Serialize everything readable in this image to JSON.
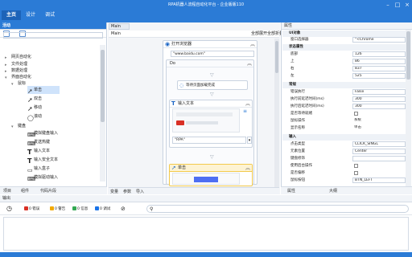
{
  "titlebar": {
    "title": "RPA机器人流程自动化平台 - 企业版版110"
  },
  "menu": {
    "tabs": [
      "主页",
      "设计",
      "调试"
    ]
  },
  "left": {
    "header": "活动",
    "tree": [
      {
        "label": "网页自动化"
      },
      {
        "label": "文件处理"
      },
      {
        "label": "数据处理"
      },
      {
        "label": "界面自动化"
      },
      {
        "label": "鼠标"
      },
      {
        "label": "单击"
      },
      {
        "label": "双击"
      },
      {
        "label": "移动"
      },
      {
        "label": "滚动"
      },
      {
        "label": "键盘"
      },
      {
        "label": "模拟键盘输入"
      },
      {
        "label": "发送热键"
      },
      {
        "label": "输入文本"
      },
      {
        "label": "输入安全文本"
      },
      {
        "label": "输入盒子"
      },
      {
        "label": "模拟驱动输入"
      }
    ],
    "footer_tabs": [
      "项目",
      "组件",
      "代码片段"
    ]
  },
  "center": {
    "tab": "Main",
    "breadcrumb": "Main",
    "expand_all": "全部展开",
    "collapse_all": "全部折叠",
    "blocks": {
      "open_browser": {
        "title": "打开浏览器",
        "url": "\"www.baidu.com\""
      },
      "do": {
        "title": "Do"
      },
      "wait": {
        "label": "等待页面加载完成"
      },
      "type_text": {
        "title": "输入文本",
        "text": "\"RPA\""
      },
      "click": {
        "title": "单击"
      }
    },
    "footer_tabs": [
      "变量",
      "参数",
      "导入"
    ]
  },
  "right": {
    "header": "属性",
    "sections": [
      {
        "title": "UI对象",
        "rows": [
          {
            "label": "窗口选择器",
            "value": "\"<Chrome"
          }
        ]
      },
      {
        "title": "状态属性",
        "rows": [
          {
            "label": "底部",
            "value": "126"
          },
          {
            "label": "上",
            "value": "86"
          },
          {
            "label": "右",
            "value": "837"
          },
          {
            "label": "左",
            "value": "525"
          }
        ]
      },
      {
        "title": "常规",
        "rows": [
          {
            "label": "错误执行",
            "value": "False"
          },
          {
            "label": "执行前延迟时间(ms)",
            "value": "300"
          },
          {
            "label": "执行后延迟时间(ms)",
            "value": "300"
          },
          {
            "label": "是否等待就绪",
            "value": ""
          },
          {
            "label": "鼠标操作",
            "value": "系统"
          },
          {
            "label": "显示名称",
            "value": "单击"
          }
        ]
      },
      {
        "title": "输入",
        "rows": [
          {
            "label": "点击类型",
            "value": "CLICK_SINGL"
          },
          {
            "label": "元素位置",
            "value": "Center"
          },
          {
            "label": "键盘修饰",
            "value": ""
          },
          {
            "label": "使用后台操作",
            "value": ""
          },
          {
            "label": "是否偏移",
            "value": ""
          },
          {
            "label": "鼠标按钮",
            "value": "BTN_LEFT"
          }
        ]
      }
    ],
    "footer_tabs": [
      "属性",
      "大纲"
    ]
  },
  "output": {
    "header": "输出",
    "counters": [
      {
        "label": "0 错误",
        "color": "#d93025"
      },
      {
        "label": "0 警告",
        "color": "#f2a900"
      },
      {
        "label": "0 信息",
        "color": "#34a853"
      },
      {
        "label": "0 调试",
        "color": "#1a73e8"
      }
    ],
    "search_placeholder": ""
  }
}
